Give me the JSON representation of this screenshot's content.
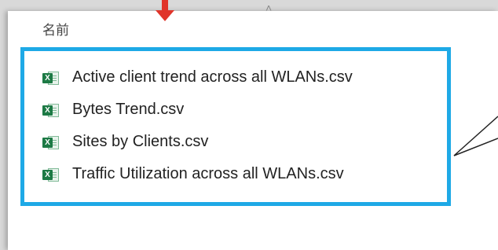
{
  "header": {
    "column_name": "名前"
  },
  "files": [
    {
      "name": "Active client trend across all WLANs.csv",
      "icon": "excel-csv-icon"
    },
    {
      "name": "Bytes Trend.csv",
      "icon": "excel-csv-icon"
    },
    {
      "name": "Sites by Clients.csv",
      "icon": "excel-csv-icon"
    },
    {
      "name": "Traffic Utilization across all WLANs.csv",
      "icon": "excel-csv-icon"
    }
  ],
  "colors": {
    "highlight": "#1ea9e6",
    "arrow": "#e0342a",
    "excel": "#1d7a45"
  }
}
